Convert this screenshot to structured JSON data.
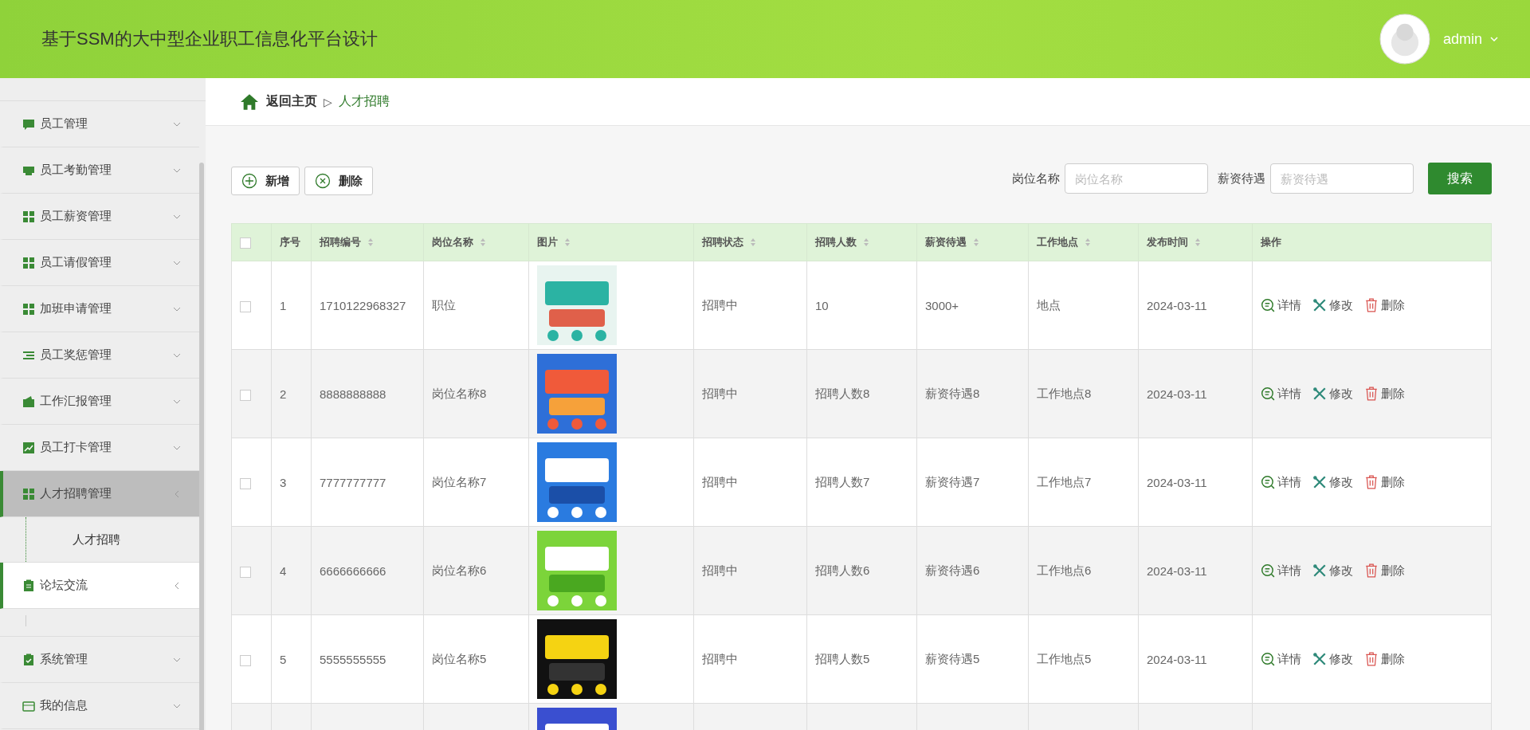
{
  "header": {
    "title": "基于SSM的大中型企业职工信息化平台设计",
    "user": "admin"
  },
  "sidebar": {
    "items": [
      {
        "label": "员工管理",
        "selected": false,
        "hovered": false,
        "expanded": false
      },
      {
        "label": "员工考勤管理",
        "selected": false,
        "hovered": false,
        "expanded": false
      },
      {
        "label": "员工薪资管理",
        "selected": false,
        "hovered": false,
        "expanded": false
      },
      {
        "label": "员工请假管理",
        "selected": false,
        "hovered": false,
        "expanded": false
      },
      {
        "label": "加班申请管理",
        "selected": false,
        "hovered": false,
        "expanded": false
      },
      {
        "label": "员工奖惩管理",
        "selected": false,
        "hovered": false,
        "expanded": false
      },
      {
        "label": "工作汇报管理",
        "selected": false,
        "hovered": false,
        "expanded": false
      },
      {
        "label": "员工打卡管理",
        "selected": false,
        "hovered": false,
        "expanded": false
      },
      {
        "label": "人才招聘管理",
        "selected": true,
        "hovered": false,
        "expanded": true,
        "children": [
          {
            "label": "人才招聘"
          }
        ]
      },
      {
        "label": "论坛交流",
        "selected": false,
        "hovered": true,
        "expanded": true
      },
      {
        "label": "系统管理",
        "selected": false,
        "hovered": false,
        "expanded": false
      },
      {
        "label": "我的信息",
        "selected": false,
        "hovered": false,
        "expanded": false
      }
    ]
  },
  "breadcrumb": {
    "home": "返回主页",
    "separator": "▷",
    "current": "人才招聘"
  },
  "toolbar": {
    "buttons": [
      {
        "label": "新增",
        "kind": "add"
      },
      {
        "label": "删除",
        "kind": "delete"
      }
    ],
    "filters": [
      {
        "label": "岗位名称",
        "placeholder": "岗位名称"
      },
      {
        "label": "薪资待遇",
        "placeholder": "薪资待遇"
      }
    ],
    "search": "搜索"
  },
  "table": {
    "header_checked": false,
    "columns": [
      {
        "label": "序号",
        "sortable": false
      },
      {
        "label": "招聘编号",
        "sortable": true
      },
      {
        "label": "岗位名称",
        "sortable": true
      },
      {
        "label": "图片",
        "sortable": true
      },
      {
        "label": "招聘状态",
        "sortable": true
      },
      {
        "label": "招聘人数",
        "sortable": true
      },
      {
        "label": "薪资待遇",
        "sortable": true
      },
      {
        "label": "工作地点",
        "sortable": true
      },
      {
        "label": "发布时间",
        "sortable": true
      },
      {
        "label": "操作",
        "sortable": false
      }
    ],
    "rows": [
      {
        "checked": false,
        "cells": [
          "1",
          "1710122968327",
          "职位",
          {
            "kind": "picture"
          },
          "招聘中",
          "10",
          "3000+",
          "地点",
          "2024-03-11"
        ],
        "actions": [
          {
            "label": "详情",
            "kind": "detail"
          },
          {
            "label": "修改",
            "kind": "edit"
          },
          {
            "label": "删除",
            "kind": "delete"
          }
        ]
      },
      {
        "checked": false,
        "cells": [
          "2",
          "8888888888",
          "岗位名称8",
          {
            "kind": "picture"
          },
          "招聘中",
          "招聘人数8",
          "薪资待遇8",
          "工作地点8",
          "2024-03-11"
        ],
        "actions": [
          {
            "label": "详情",
            "kind": "detail"
          },
          {
            "label": "修改",
            "kind": "edit"
          },
          {
            "label": "删除",
            "kind": "delete"
          }
        ]
      },
      {
        "checked": false,
        "cells": [
          "3",
          "7777777777",
          "岗位名称7",
          {
            "kind": "picture"
          },
          "招聘中",
          "招聘人数7",
          "薪资待遇7",
          "工作地点7",
          "2024-03-11"
        ],
        "actions": [
          {
            "label": "详情",
            "kind": "detail"
          },
          {
            "label": "修改",
            "kind": "edit"
          },
          {
            "label": "删除",
            "kind": "delete"
          }
        ]
      },
      {
        "checked": false,
        "cells": [
          "4",
          "6666666666",
          "岗位名称6",
          {
            "kind": "picture"
          },
          "招聘中",
          "招聘人数6",
          "薪资待遇6",
          "工作地点6",
          "2024-03-11"
        ],
        "actions": [
          {
            "label": "详情",
            "kind": "detail"
          },
          {
            "label": "修改",
            "kind": "edit"
          },
          {
            "label": "删除",
            "kind": "delete"
          }
        ]
      },
      {
        "checked": false,
        "cells": [
          "5",
          "5555555555",
          "岗位名称5",
          {
            "kind": "picture"
          },
          "招聘中",
          "招聘人数5",
          "薪资待遇5",
          "工作地点5",
          "2024-03-11"
        ],
        "actions": [
          {
            "label": "详情",
            "kind": "detail"
          },
          {
            "label": "修改",
            "kind": "edit"
          },
          {
            "label": "删除",
            "kind": "delete"
          }
        ]
      },
      {
        "cells": [
          null,
          null,
          null,
          {
            "kind": "picture"
          },
          null,
          null,
          null,
          null,
          null
        ],
        "actions": []
      }
    ]
  }
}
